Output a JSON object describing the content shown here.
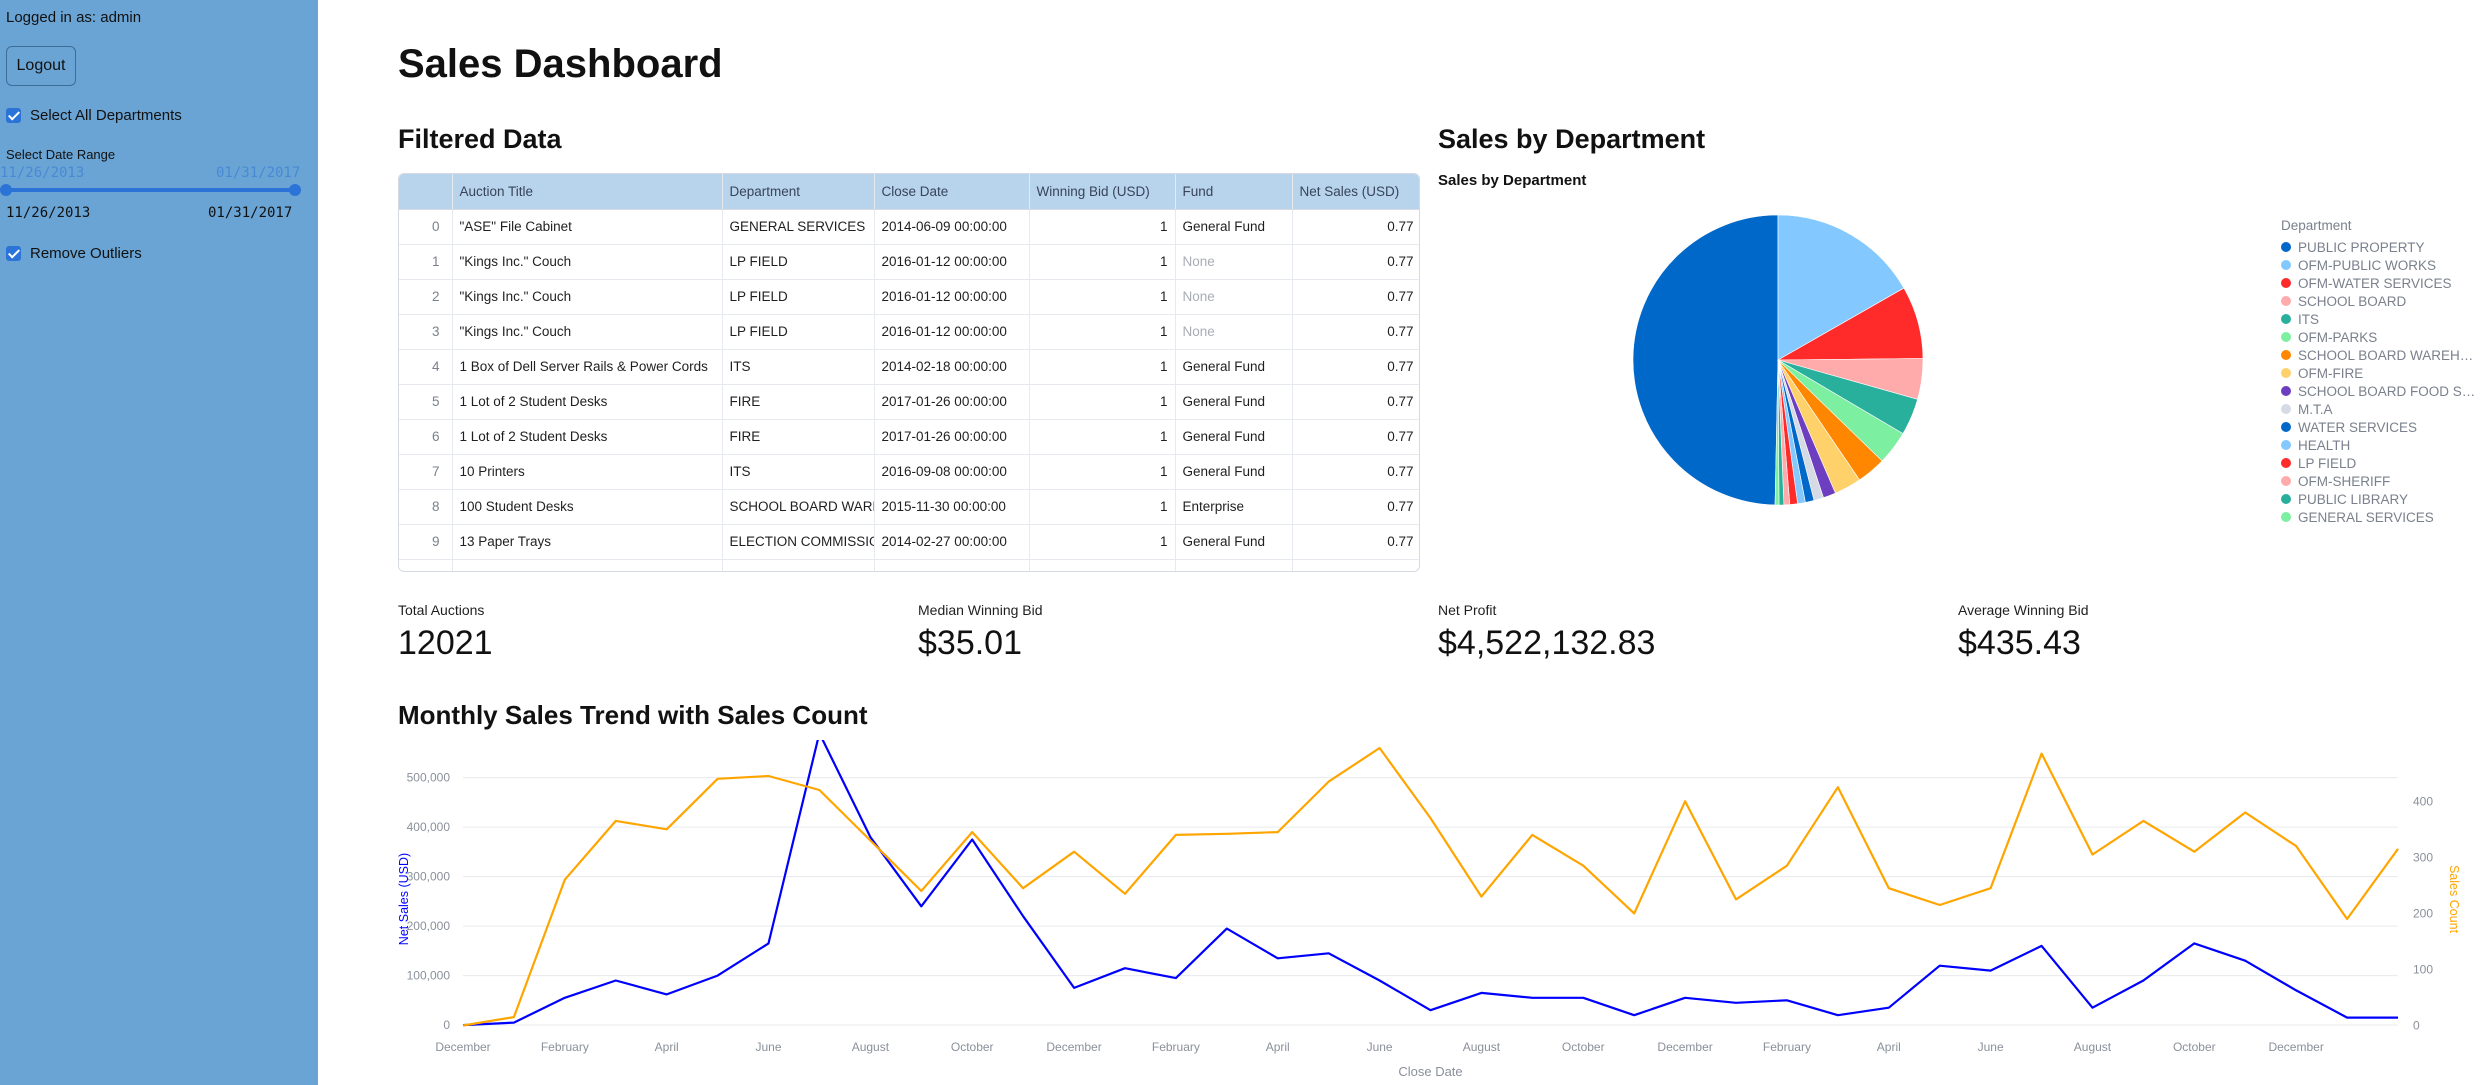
{
  "sidebar": {
    "logged_in": "Logged in as: admin",
    "logout_label": "Logout",
    "select_all_label": "Select All Departments",
    "date_range_label": "Select Date Range",
    "date_start": "11/26/2013",
    "date_end": "01/31/2017",
    "remove_outliers_label": "Remove Outliers"
  },
  "page_title": "Sales Dashboard",
  "filtered_data": {
    "heading": "Filtered Data",
    "columns": [
      "",
      "Auction Title",
      "Department",
      "Close Date",
      "Winning Bid (USD)",
      "Fund",
      "Net Sales (USD)"
    ],
    "rows": [
      [
        "0",
        "\"ASE\" File Cabinet",
        "GENERAL SERVICES",
        "2014-06-09 00:00:00",
        "1",
        "General Fund",
        "0.77"
      ],
      [
        "1",
        "\"Kings Inc.\" Couch",
        "LP FIELD",
        "2016-01-12 00:00:00",
        "1",
        "None",
        "0.77"
      ],
      [
        "2",
        "\"Kings Inc.\" Couch",
        "LP FIELD",
        "2016-01-12 00:00:00",
        "1",
        "None",
        "0.77"
      ],
      [
        "3",
        "\"Kings Inc.\" Couch",
        "LP FIELD",
        "2016-01-12 00:00:00",
        "1",
        "None",
        "0.77"
      ],
      [
        "4",
        "1 Box of Dell Server Rails & Power Cords",
        "ITS",
        "2014-02-18 00:00:00",
        "1",
        "General Fund",
        "0.77"
      ],
      [
        "5",
        "1 Lot of 2 Student Desks",
        "FIRE",
        "2017-01-26 00:00:00",
        "1",
        "General Fund",
        "0.77"
      ],
      [
        "6",
        "1 Lot of 2 Student Desks",
        "FIRE",
        "2017-01-26 00:00:00",
        "1",
        "General Fund",
        "0.77"
      ],
      [
        "7",
        "10 Printers",
        "ITS",
        "2016-09-08 00:00:00",
        "1",
        "General Fund",
        "0.77"
      ],
      [
        "8",
        "100 Student Desks",
        "SCHOOL BOARD WAREHOUSE",
        "2015-11-30 00:00:00",
        "1",
        "Enterprise",
        "0.77"
      ],
      [
        "9",
        "13 Paper Trays",
        "ELECTION COMMISSION",
        "2014-02-27 00:00:00",
        "1",
        "General Fund",
        "0.77"
      ]
    ]
  },
  "sales_by_department": {
    "heading": "Sales by Department",
    "chart_title": "Sales by Department",
    "legend_title": "Department",
    "legend": [
      {
        "label": "PUBLIC PROPERTY",
        "color": "#0068c9"
      },
      {
        "label": "OFM-PUBLIC WORKS",
        "color": "#83c9ff"
      },
      {
        "label": "OFM-WATER SERVICES",
        "color": "#ff2b2b"
      },
      {
        "label": "SCHOOL BOARD",
        "color": "#ffabab"
      },
      {
        "label": "ITS",
        "color": "#29b09d"
      },
      {
        "label": "OFM-PARKS",
        "color": "#7defa1"
      },
      {
        "label": "SCHOOL BOARD WAREH…",
        "color": "#ff8700"
      },
      {
        "label": "OFM-FIRE",
        "color": "#ffd16a"
      },
      {
        "label": "SCHOOL BOARD FOOD S…",
        "color": "#6d3fc0"
      },
      {
        "label": "M.T.A",
        "color": "#d5dae5"
      },
      {
        "label": "WATER SERVICES",
        "color": "#0068c9"
      },
      {
        "label": "HEALTH",
        "color": "#83c9ff"
      },
      {
        "label": "LP FIELD",
        "color": "#ff2b2b"
      },
      {
        "label": "OFM-SHERIFF",
        "color": "#ffabab"
      },
      {
        "label": "PUBLIC LIBRARY",
        "color": "#29b09d"
      },
      {
        "label": "GENERAL SERVICES",
        "color": "#7defa1"
      }
    ]
  },
  "metrics": [
    {
      "label": "Total Auctions",
      "value": "12021"
    },
    {
      "label": "Median Winning Bid",
      "value": "$35.01"
    },
    {
      "label": "Net Profit",
      "value": "$4,522,132.83"
    },
    {
      "label": "Average Winning Bid",
      "value": "$435.43"
    }
  ],
  "monthly_trend": {
    "heading": "Monthly Sales Trend with Sales Count"
  },
  "chart_data": [
    {
      "type": "pie",
      "title": "Sales by Department",
      "legend_title": "Department",
      "legend_position": "right",
      "slices": [
        {
          "label": "PUBLIC PROPERTY",
          "value": 46.0,
          "color": "#0068c9"
        },
        {
          "label": "OFM-PUBLIC WORKS",
          "value": 15.5,
          "color": "#83c9ff"
        },
        {
          "label": "OFM-WATER SERVICES",
          "value": 7.5,
          "color": "#ff2b2b"
        },
        {
          "label": "SCHOOL BOARD",
          "value": 4.2,
          "color": "#ffabab"
        },
        {
          "label": "ITS",
          "value": 3.8,
          "color": "#29b09d"
        },
        {
          "label": "OFM-PARKS",
          "value": 3.5,
          "color": "#7defa1"
        },
        {
          "label": "SCHOOL BOARD WAREH…",
          "value": 3.0,
          "color": "#ff8700"
        },
        {
          "label": "OFM-FIRE",
          "value": 2.8,
          "color": "#ffd16a"
        },
        {
          "label": "SCHOOL BOARD FOOD S…",
          "value": 1.3,
          "color": "#6d3fc0"
        },
        {
          "label": "M.T.A",
          "value": 1.0,
          "color": "#d5dae5"
        },
        {
          "label": "WATER SERVICES",
          "value": 0.9,
          "color": "#0068c9"
        },
        {
          "label": "HEALTH",
          "value": 0.8,
          "color": "#83c9ff"
        },
        {
          "label": "LP FIELD",
          "value": 0.8,
          "color": "#ff2b2b"
        },
        {
          "label": "OFM-SHERIFF",
          "value": 0.6,
          "color": "#ffabab"
        },
        {
          "label": "PUBLIC LIBRARY",
          "value": 0.5,
          "color": "#29b09d"
        },
        {
          "label": "GENERAL SERVICES",
          "value": 0.4,
          "color": "#7defa1"
        }
      ]
    },
    {
      "type": "line",
      "title": "Monthly Sales Trend with Sales Count",
      "xlabel": "Close Date",
      "ylabel": "Net Sales (USD)",
      "y2label": "Sales Count",
      "x_tick_labels": [
        "December",
        "February",
        "April",
        "June",
        "August",
        "October",
        "December",
        "February",
        "April",
        "June",
        "August",
        "October",
        "December",
        "February",
        "April",
        "June",
        "August",
        "October",
        "December"
      ],
      "ylim": [
        -10000,
        560000
      ],
      "y_ticks": [
        0,
        100000,
        200000,
        300000,
        400000,
        500000
      ],
      "y_tick_labels": [
        "0",
        "100,000",
        "200,000",
        "300,000",
        "400,000",
        "500,000"
      ],
      "y2lim": [
        -8,
        495
      ],
      "y2_ticks": [
        0,
        100,
        200,
        300,
        400
      ],
      "grid": true,
      "series": [
        {
          "name": "Net Sales (USD)",
          "axis": "left",
          "color": "#0000ff",
          "values": [
            0,
            5000,
            55000,
            90000,
            62000,
            100000,
            165000,
            590000,
            380000,
            240000,
            375000,
            220000,
            75000,
            115000,
            95000,
            195000,
            135000,
            145000,
            90000,
            30000,
            65000,
            55000,
            55000,
            20000,
            55000,
            45000,
            50000,
            20000,
            35000,
            120000,
            110000,
            160000,
            35000,
            90000,
            165000,
            130000,
            70000,
            15000,
            15000
          ]
        },
        {
          "name": "Sales Count",
          "axis": "right",
          "color": "#ffa500",
          "values": [
            0,
            15,
            260,
            365,
            350,
            440,
            445,
            420,
            330,
            240,
            345,
            245,
            310,
            235,
            340,
            342,
            345,
            435,
            495,
            370,
            230,
            340,
            285,
            200,
            400,
            225,
            285,
            425,
            245,
            215,
            245,
            485,
            305,
            365,
            310,
            380,
            320,
            190,
            315
          ]
        }
      ]
    }
  ]
}
